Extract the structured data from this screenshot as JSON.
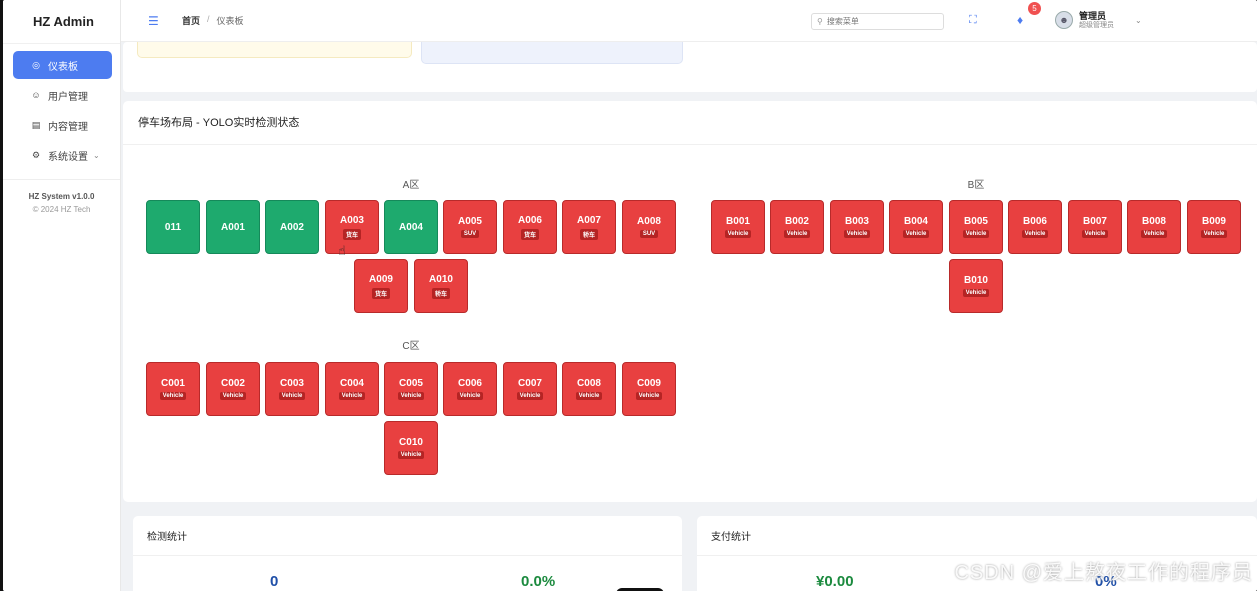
{
  "app": {
    "title": "HZ Admin"
  },
  "sidebar": {
    "items": [
      {
        "label": "仪表板",
        "icon": "dashboard-icon"
      },
      {
        "label": "用户管理",
        "icon": "user-icon"
      },
      {
        "label": "内容管理",
        "icon": "document-icon"
      },
      {
        "label": "系统设置",
        "icon": "gear-icon"
      }
    ],
    "version": "HZ System v1.0.0",
    "copyright": "© 2024 HZ Tech"
  },
  "header": {
    "breadcrumb": {
      "home": "首页",
      "separator": "/",
      "current": "仪表板"
    },
    "search_placeholder": "搜索菜单",
    "notification_count": "5",
    "user_name": "管理员",
    "user_role": "超级管理员"
  },
  "parking": {
    "title": "停车场布局 - YOLO实时检测状态",
    "zones": {
      "a": "A区",
      "b": "B区",
      "c": "C区"
    },
    "slots": {
      "s011": {
        "id": "011",
        "status": "free"
      },
      "A001": {
        "id": "A001",
        "status": "free"
      },
      "A002": {
        "id": "A002",
        "status": "free"
      },
      "A003": {
        "id": "A003",
        "status": "occupied",
        "type": "货车"
      },
      "A004": {
        "id": "A004",
        "status": "free"
      },
      "A005": {
        "id": "A005",
        "status": "occupied",
        "type": "SUV"
      },
      "A006": {
        "id": "A006",
        "status": "occupied",
        "type": "货车"
      },
      "A007": {
        "id": "A007",
        "status": "occupied",
        "type": "轿车"
      },
      "A008": {
        "id": "A008",
        "status": "occupied",
        "type": "SUV"
      },
      "A009": {
        "id": "A009",
        "status": "occupied",
        "type": "货车"
      },
      "A010": {
        "id": "A010",
        "status": "occupied",
        "type": "轿车"
      },
      "B001": {
        "id": "B001",
        "status": "occupied",
        "type": "Vehicle"
      },
      "B002": {
        "id": "B002",
        "status": "occupied",
        "type": "Vehicle"
      },
      "B003": {
        "id": "B003",
        "status": "occupied",
        "type": "Vehicle"
      },
      "B004": {
        "id": "B004",
        "status": "occupied",
        "type": "Vehicle"
      },
      "B005": {
        "id": "B005",
        "status": "occupied",
        "type": "Vehicle"
      },
      "B006": {
        "id": "B006",
        "status": "occupied",
        "type": "Vehicle"
      },
      "B007": {
        "id": "B007",
        "status": "occupied",
        "type": "Vehicle"
      },
      "B008": {
        "id": "B008",
        "status": "occupied",
        "type": "Vehicle"
      },
      "B009": {
        "id": "B009",
        "status": "occupied",
        "type": "Vehicle"
      },
      "B010": {
        "id": "B010",
        "status": "occupied",
        "type": "Vehicle"
      },
      "C001": {
        "id": "C001",
        "status": "occupied",
        "type": "Vehicle"
      },
      "C002": {
        "id": "C002",
        "status": "occupied",
        "type": "Vehicle"
      },
      "C003": {
        "id": "C003",
        "status": "occupied",
        "type": "Vehicle"
      },
      "C004": {
        "id": "C004",
        "status": "occupied",
        "type": "Vehicle"
      },
      "C005": {
        "id": "C005",
        "status": "occupied",
        "type": "Vehicle"
      },
      "C006": {
        "id": "C006",
        "status": "occupied",
        "type": "Vehicle"
      },
      "C007": {
        "id": "C007",
        "status": "occupied",
        "type": "Vehicle"
      },
      "C008": {
        "id": "C008",
        "status": "occupied",
        "type": "Vehicle"
      },
      "C009": {
        "id": "C009",
        "status": "occupied",
        "type": "Vehicle"
      },
      "C010": {
        "id": "C010",
        "status": "occupied",
        "type": "Vehicle"
      }
    }
  },
  "stats": {
    "detection": {
      "title": "检测统计",
      "count": "0",
      "rate": "0.0%"
    },
    "payment": {
      "title": "支付统计",
      "amount": "¥0.00",
      "rate": "0%"
    }
  },
  "watermark": "CSDN @爱上熬夜工作的程序员",
  "colors": {
    "accent": "#4d7cf0",
    "occupied": "#e84040",
    "free": "#1eaa6e"
  }
}
